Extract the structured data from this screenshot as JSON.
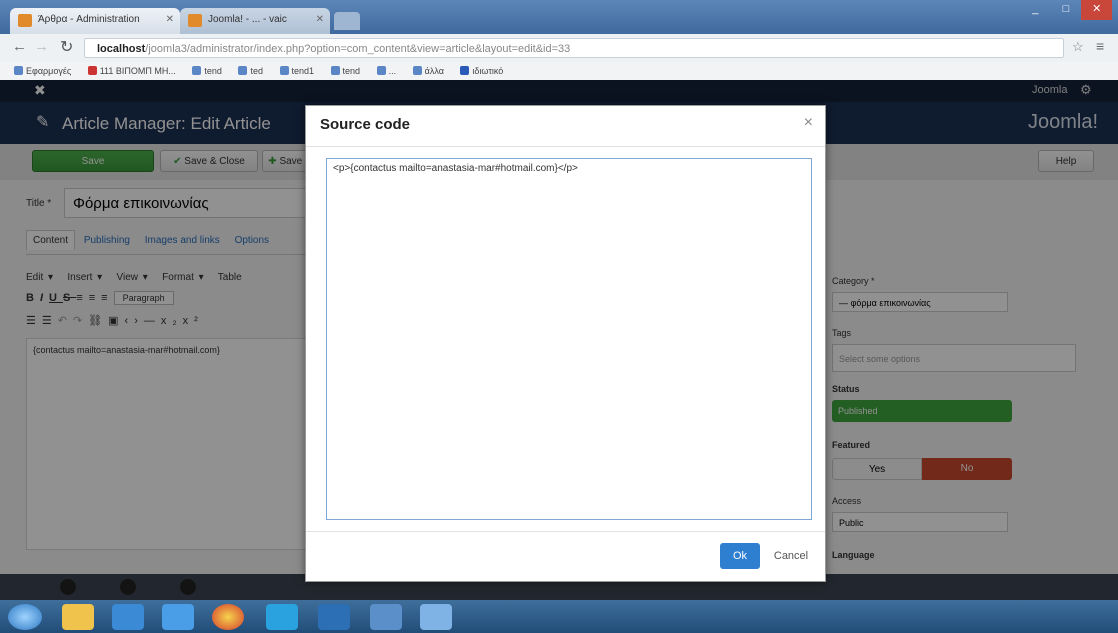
{
  "browser": {
    "tabs": [
      {
        "label": "Άρθρα - Administration"
      },
      {
        "label": "Joomla! - ... - vaic"
      }
    ],
    "window_controls": [
      "_",
      "□",
      "✕"
    ],
    "url": {
      "host": "localhost",
      "path": "/joomla3/administrator/index.php?option=com_content&view=article&layout=edit&id=33"
    },
    "bookmarks": [
      "Εφαρμογές",
      "111 ΒΙΠΟΜΠ ΜΗ...",
      "tend",
      "ted",
      "tend1",
      "tend",
      "...",
      "άλλα",
      "ιδιωτικό"
    ]
  },
  "joomla": {
    "topbar_user": "Joomla",
    "header_title": "Article Manager: Edit Article",
    "logo_text": "Joomla!",
    "toolbar": {
      "save": "Save",
      "save_close": "Save & Close",
      "save_new": "Save &",
      "help": "Help"
    },
    "title_label": "Title *",
    "title_value": "Φόρμα επικοινωνίας",
    "tabs": [
      "Content",
      "Publishing",
      "Images and links",
      "Options"
    ],
    "editor_menus": [
      "Edit ▾",
      "Insert ▾",
      "View ▾",
      "Format ▾",
      "Table"
    ],
    "paragraph_select": "Paragraph",
    "editor_content": "{contactus mailto=anastasia-mar#hotmail.com}",
    "sidebar": {
      "category_label": "Category *",
      "category_value": "— φόρμα επικοινωνίας",
      "tags_label": "Tags",
      "tags_value": "Select some options",
      "status_label": "Status",
      "status_value": "Published",
      "featured_label": "Featured",
      "featured_yes": "Yes",
      "featured_no": "No",
      "access_label": "Access",
      "access_value": "Public",
      "language_label": "Language"
    }
  },
  "modal": {
    "title": "Source code",
    "close": "×",
    "code": "<p>{contactus mailto=anastasia-mar#hotmail.com}</p>",
    "ok": "Ok",
    "cancel": "Cancel"
  }
}
